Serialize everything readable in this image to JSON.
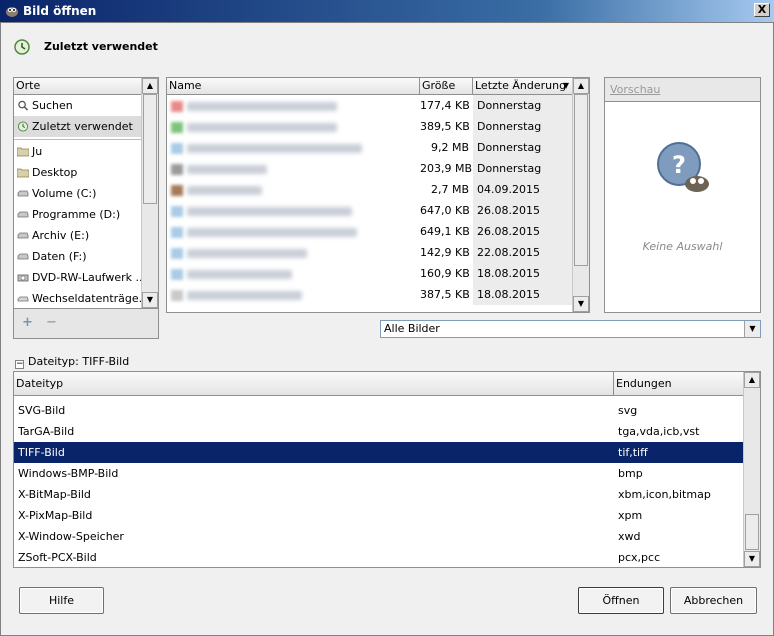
{
  "window": {
    "title": "Bild öffnen",
    "close_label": "X"
  },
  "breadcrumb": {
    "label": "Zuletzt verwendet"
  },
  "places": {
    "header": "Orte",
    "items": [
      {
        "label": "Suchen",
        "icon": "search-icon"
      },
      {
        "label": "Zuletzt verwendet",
        "icon": "recent-icon",
        "selected": true
      },
      {
        "label": "Ju",
        "icon": "folder-icon"
      },
      {
        "label": "Desktop",
        "icon": "folder-icon"
      },
      {
        "label": "Volume (C:)",
        "icon": "drive-icon"
      },
      {
        "label": "Programme (D:)",
        "icon": "drive-icon"
      },
      {
        "label": "Archiv (E:)",
        "icon": "drive-icon"
      },
      {
        "label": "Daten (F:)",
        "icon": "drive-icon"
      },
      {
        "label": "DVD-RW-Laufwerk ...",
        "icon": "optical-drive-icon"
      },
      {
        "label": "Wechseldatenträge...",
        "icon": "removable-drive-icon"
      }
    ],
    "add_label": "+",
    "remove_label": "−"
  },
  "files": {
    "columns": {
      "name": "Name",
      "size": "Größe",
      "modified": "Letzte Änderung"
    },
    "rows": [
      {
        "size": "177,4 KB",
        "modified": "Donnerstag",
        "color": "#e88a8a"
      },
      {
        "size": "389,5 KB",
        "modified": "Donnerstag",
        "color": "#7cc47c"
      },
      {
        "size": "9,2 MB",
        "modified": "Donnerstag",
        "color": "#a9cbe6"
      },
      {
        "size": "203,9 MB",
        "modified": "Donnerstag",
        "color": "#9a9a9a"
      },
      {
        "size": "2,7 MB",
        "modified": "04.09.2015",
        "color": "#a47a5a"
      },
      {
        "size": "647,0 KB",
        "modified": "26.08.2015",
        "color": "#a9cbe6"
      },
      {
        "size": "649,1 KB",
        "modified": "26.08.2015",
        "color": "#a9cbe6"
      },
      {
        "size": "142,9 KB",
        "modified": "22.08.2015",
        "color": "#a9cbe6"
      },
      {
        "size": "160,9 KB",
        "modified": "18.08.2015",
        "color": "#a9cbe6"
      },
      {
        "size": "387,5 KB",
        "modified": "18.08.2015",
        "color": "#c9c9c9"
      }
    ]
  },
  "preview": {
    "button_label": "Vorschau",
    "empty_text": "Keine Auswahl"
  },
  "filter": {
    "selected": "Alle Bilder"
  },
  "filetype": {
    "toggle_label": "Dateityp: TIFF-Bild",
    "columns": {
      "type": "Dateityp",
      "ext": "Endungen"
    },
    "rows": [
      {
        "type": "SVG-Bild",
        "ext": "svg"
      },
      {
        "type": "TarGA-Bild",
        "ext": "tga,vda,icb,vst"
      },
      {
        "type": "TIFF-Bild",
        "ext": "tif,tiff",
        "selected": true
      },
      {
        "type": "Windows-BMP-Bild",
        "ext": "bmp"
      },
      {
        "type": "X-BitMap-Bild",
        "ext": "xbm,icon,bitmap"
      },
      {
        "type": "X-PixMap-Bild",
        "ext": "xpm"
      },
      {
        "type": "X-Window-Speicher",
        "ext": "xwd"
      },
      {
        "type": "ZSoft-PCX-Bild",
        "ext": "pcx,pcc"
      }
    ]
  },
  "buttons": {
    "help": "Hilfe",
    "open": "Öffnen",
    "cancel": "Abbrechen"
  }
}
